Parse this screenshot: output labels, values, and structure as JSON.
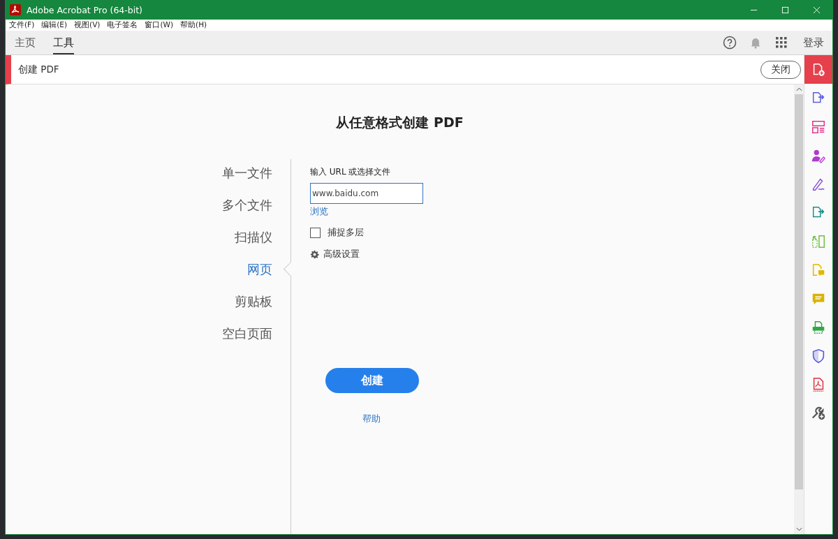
{
  "window": {
    "title": "Adobe Acrobat Pro (64-bit)"
  },
  "menu": [
    "文件(F)",
    "编辑(E)",
    "视图(V)",
    "电子签名",
    "窗口(W)",
    "帮助(H)"
  ],
  "tabs": [
    {
      "label": "主页",
      "selected": false
    },
    {
      "label": "工具",
      "selected": true
    }
  ],
  "sign_in": "登录",
  "tool_header": {
    "title": "创建 PDF",
    "close": "关闭"
  },
  "heading": "从任意格式创建 PDF",
  "sources": [
    {
      "label": "单一文件",
      "selected": false
    },
    {
      "label": "多个文件",
      "selected": false
    },
    {
      "label": "扫描仪",
      "selected": false
    },
    {
      "label": "网页",
      "selected": true
    },
    {
      "label": "剪贴板",
      "selected": false
    },
    {
      "label": "空白页面",
      "selected": false
    }
  ],
  "form": {
    "label": "输入 URL 或选择文件",
    "url": "www.baidu.com",
    "browse": "浏览",
    "capture": {
      "label": "捕捉多层",
      "checked": false
    },
    "advanced": "高级设置"
  },
  "create_button": "创建",
  "help_link": "帮助",
  "tool_rail": [
    {
      "kind": "doc-plus",
      "color": "#ffffff",
      "selected": true
    },
    {
      "kind": "doc-arrow",
      "color": "#5c5ce0",
      "selected": false
    },
    {
      "kind": "layout",
      "color": "#e0338a",
      "selected": false
    },
    {
      "kind": "person",
      "color": "#b03ad0",
      "selected": false
    },
    {
      "kind": "pen",
      "color": "#8a4fd8",
      "selected": false
    },
    {
      "kind": "doc-arrow",
      "color": "#14918c",
      "selected": false
    },
    {
      "kind": "split",
      "color": "#6ec13e",
      "selected": false
    },
    {
      "kind": "doc-comment",
      "color": "#e0b800",
      "selected": false
    },
    {
      "kind": "comment",
      "color": "#d9b300",
      "selected": false
    },
    {
      "kind": "print",
      "color": "#2ea845",
      "selected": false
    },
    {
      "kind": "shield",
      "color": "#5a5ae0",
      "selected": false
    },
    {
      "kind": "doc",
      "color": "#e0303c",
      "selected": false
    },
    {
      "kind": "wrench",
      "color": "#555555",
      "selected": false
    }
  ]
}
